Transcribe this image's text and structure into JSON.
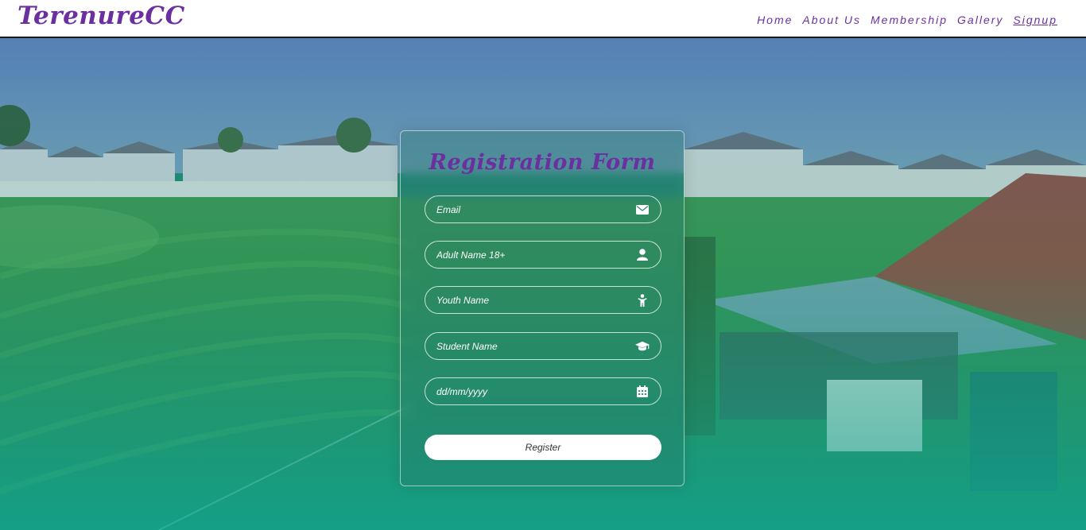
{
  "header": {
    "logo": "TerenureCC",
    "nav": [
      {
        "label": "Home"
      },
      {
        "label": "About Us"
      },
      {
        "label": "Membership"
      },
      {
        "label": "Gallery"
      },
      {
        "label": "Signup",
        "active": true
      }
    ]
  },
  "form": {
    "title": "Registration Form",
    "fields": [
      {
        "placeholder": "Email",
        "icon": "envelope-icon"
      },
      {
        "placeholder": "Adult Name 18+",
        "icon": "user-icon"
      },
      {
        "placeholder": "Youth Name",
        "icon": "child-icon"
      },
      {
        "placeholder": "Student Name",
        "icon": "graduation-cap-icon"
      },
      {
        "placeholder": "dd/mm/yyyy",
        "icon": "calendar-icon"
      }
    ],
    "submit_label": "Register"
  },
  "colors": {
    "brand": "#6b2fa0",
    "overlay_top": "#5a8fb4",
    "overlay_bottom": "#13a394"
  }
}
